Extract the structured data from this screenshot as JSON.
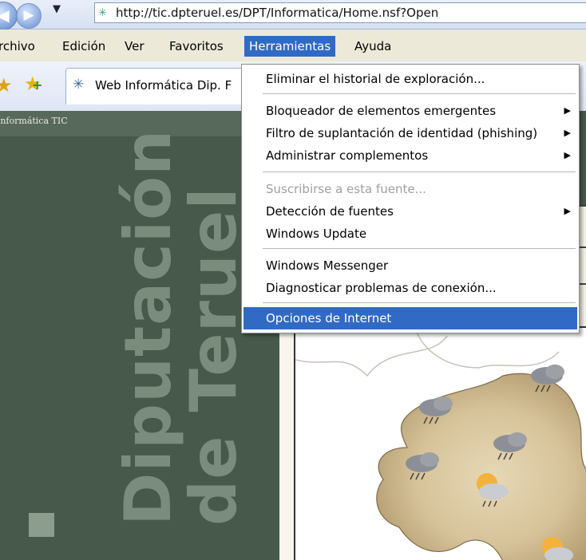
{
  "addressbar": {
    "back_glyph": "◀",
    "forward_glyph": "▶",
    "recent_dropdown_glyph": "▼",
    "url": "http://tic.dpteruel.es/DPT/Informatica/Home.nsf?Open",
    "favicon": "page-icon"
  },
  "menubar": {
    "items": [
      "rchivo",
      "Edición",
      "Ver",
      "Favoritos",
      "Herramientas",
      "Ayuda"
    ],
    "active": "Herramientas"
  },
  "tabs": {
    "favorites_star_glyph": "★",
    "add_favorite_glyph": "★",
    "active_tab_label": "Web Informática Dip. F",
    "tab_icon_glyph": "✳"
  },
  "page": {
    "breadcrumb": "Informática TIC",
    "logo_line1": "Diputación",
    "logo_line2": "de Teruel",
    "panel_color": "#47594b"
  },
  "tools_menu": {
    "items": [
      {
        "label": "Eliminar el historial de exploración...",
        "submenu": false,
        "disabled": false
      },
      {
        "label": "Bloqueador de elementos emergentes",
        "submenu": true,
        "disabled": false
      },
      {
        "label": "Filtro de suplantación de identidad (phishing)",
        "submenu": true,
        "disabled": false
      },
      {
        "label": "Administrar complementos",
        "submenu": true,
        "disabled": false
      },
      {
        "label": "Suscribirse a esta fuente...",
        "submenu": false,
        "disabled": true
      },
      {
        "label": "Detección de fuentes",
        "submenu": true,
        "disabled": false
      },
      {
        "label": "Windows Update",
        "submenu": false,
        "disabled": false
      },
      {
        "label": "Windows Messenger",
        "submenu": false,
        "disabled": false
      },
      {
        "label": "Diagnosticar problemas de conexión...",
        "submenu": false,
        "disabled": false
      },
      {
        "label": "Opciones de Internet",
        "submenu": false,
        "disabled": false,
        "highlighted": true
      }
    ],
    "submenu_arrow_glyph": "▶",
    "highlight_color": "#316ac5"
  }
}
